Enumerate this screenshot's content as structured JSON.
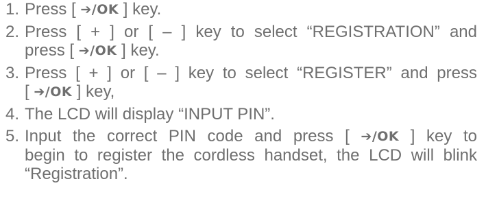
{
  "key_label": "OK",
  "key_glyph": "➔",
  "steps": [
    {
      "num": "1.",
      "lines": [
        {
          "pre": "Press [ ",
          "key": true,
          "post": " ] key."
        }
      ]
    },
    {
      "num": "2.",
      "lines": [
        {
          "text": "Press [ + ] or [ – ] key to select “REGISTRATION” and",
          "justified": true
        },
        {
          "pre": "press [ ",
          "key": true,
          "post": " ] key."
        }
      ]
    },
    {
      "num": "3.",
      "lines": [
        {
          "text": "Press [ + ] or [ – ] key to select “REGISTER” and press",
          "justified": true
        },
        {
          "pre": "[ ",
          "key": true,
          "post": " ] key,"
        }
      ]
    },
    {
      "num": "4.",
      "lines": [
        {
          "text": "The LCD will display “INPUT PIN”."
        }
      ]
    },
    {
      "num": "5.",
      "lines": [
        {
          "pre": "Input the correct PIN code and press [ ",
          "key": true,
          "post": " ] key to",
          "justified": true
        },
        {
          "text": "begin to register the cordless handset, the LCD will blink",
          "justified": true
        },
        {
          "text": "“Registration”."
        }
      ]
    }
  ]
}
